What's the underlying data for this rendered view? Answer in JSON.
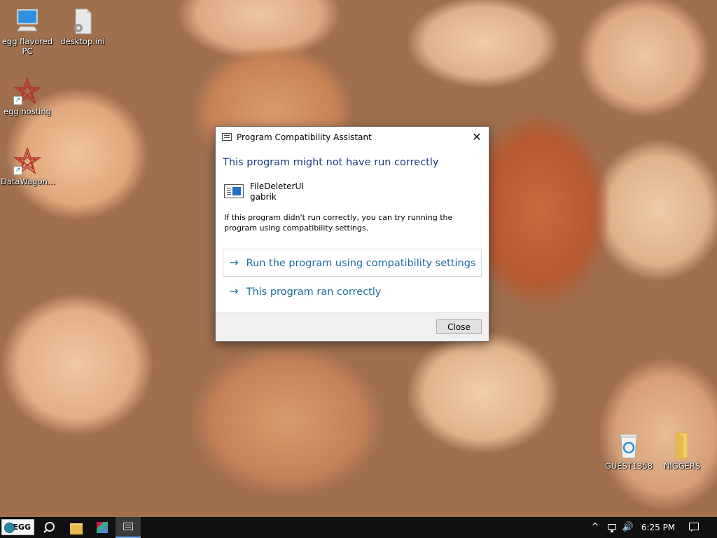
{
  "desktop": {
    "icons": [
      {
        "label": "egg flavored PC",
        "icon": "computer-icon"
      },
      {
        "label": "desktop.ini",
        "icon": "file-icon"
      },
      {
        "label": "egg hosting",
        "icon": "app-shortcut-icon"
      },
      {
        "label": "DataWagon...",
        "icon": "app-shortcut-icon"
      },
      {
        "label": "GUEST1358",
        "icon": "recycle-bin-icon"
      },
      {
        "label": "NIGGERS",
        "icon": "folder-icon"
      }
    ]
  },
  "dialog": {
    "title": "Program Compatibility Assistant",
    "close_glyph": "✕",
    "heading": "This program might not have run correctly",
    "app_name": "FileDeleterUI",
    "app_publisher": "gabrik",
    "description": "If this program didn't run correctly, you can try running the program using compatibility settings.",
    "options": [
      {
        "label": "Run the program using compatibility settings"
      },
      {
        "label": "This program ran correctly"
      }
    ],
    "arrow_glyph": "→",
    "close_button": "Close"
  },
  "taskbar": {
    "start_label": "EGG",
    "tray_chevron": "^",
    "volume_glyph": "🔊",
    "clock": "6:25 PM"
  },
  "colors": {
    "heading": "#1e3b8a",
    "link": "#1a6b9a",
    "taskbar": "#101010"
  }
}
